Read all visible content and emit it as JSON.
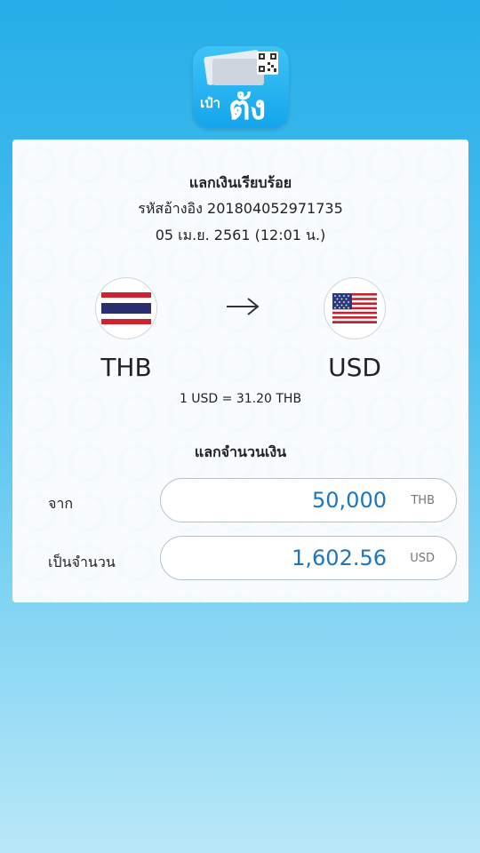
{
  "app": {
    "logo_text_small": "เป๋า",
    "logo_text_big": "ตัง"
  },
  "result": {
    "title": "แลกเงินเรียบร้อย",
    "reference": "รหัสอ้างอิง 201804052971735",
    "datetime": "05 เม.ย. 2561 (12:01 น.)"
  },
  "exchange": {
    "from_code": "THB",
    "to_code": "USD",
    "from_flag": "thailand-flag",
    "to_flag": "usa-flag",
    "arrow_icon": "arrow-right-icon",
    "rate_text": "1 USD = 31.20 THB",
    "section_title": "แลกจำนวนเงิน",
    "from_label": "จาก",
    "from_amount": "50,000",
    "from_unit": "THB",
    "to_label": "เป็นจำนวน",
    "to_amount": "1,602.56",
    "to_unit": "USD"
  },
  "colors": {
    "background": "#26aee8",
    "amount_text": "#1a76bf"
  }
}
